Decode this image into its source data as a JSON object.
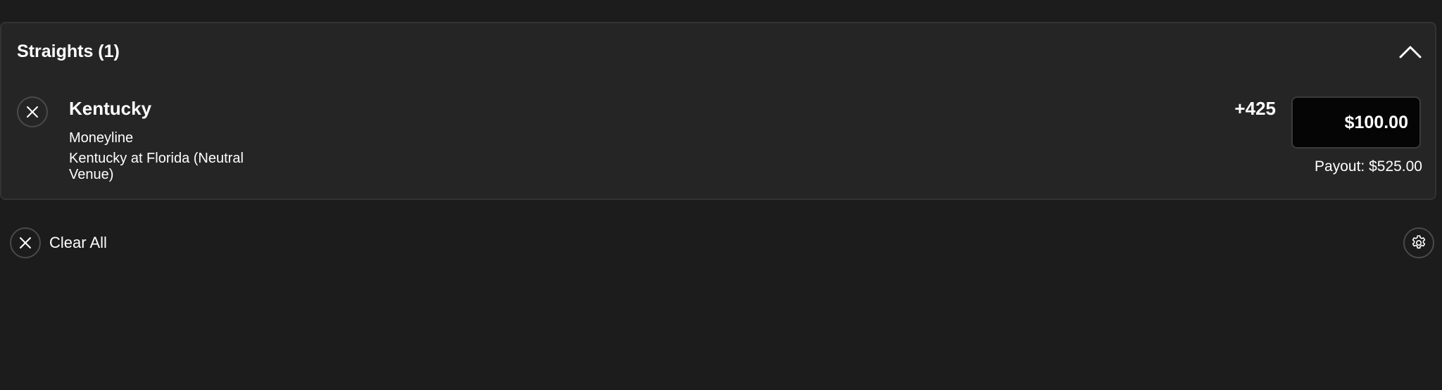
{
  "section": {
    "title": "Straights (1)",
    "collapse_icon": "chevron-up-icon"
  },
  "bet": {
    "remove_icon": "close-icon",
    "selection": "Kentucky",
    "market": "Moneyline",
    "event": "Kentucky at Florida (Neutral Venue)",
    "odds": "+425",
    "stake": "$100.00",
    "payout": "Payout: $525.00"
  },
  "footer": {
    "clear_label": "Clear All",
    "clear_icon": "close-icon",
    "settings_icon": "gear-icon"
  },
  "colors": {
    "background": "#1c1c1c",
    "panel": "#252525",
    "panel_border": "#333333",
    "input_background": "#050505",
    "text": "#ffffff"
  }
}
